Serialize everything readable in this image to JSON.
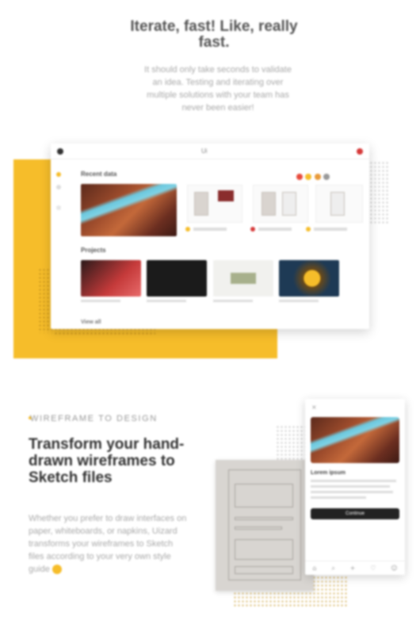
{
  "hero": {
    "title": "Iterate, fast! Like, really fast.",
    "body": "It should only take seconds to validate an idea. Testing and iterating over multiple solutions with your team has never been easier!"
  },
  "desktop": {
    "window_title": "Ui",
    "recent_label": "Recent data",
    "projects_label": "Projects",
    "more_label": "View all"
  },
  "wireframe": {
    "eyebrow": "WIREFRAME TO DESIGN",
    "title": "Transform your hand-drawn wireframes to Sketch files",
    "body": "Whether you prefer to draw interfaces on paper, whiteboards, or napkins, Uizard transforms your wireframes to Sketch files according to your very own style guide"
  },
  "phone": {
    "card_title": "Lorem ipsum",
    "button_label": "Continue",
    "tab_icons": [
      "home-icon",
      "search-icon",
      "plus-icon",
      "heart-icon",
      "user-icon"
    ]
  },
  "colors": {
    "accent": "#f6bd2a",
    "dark": "#222222"
  }
}
